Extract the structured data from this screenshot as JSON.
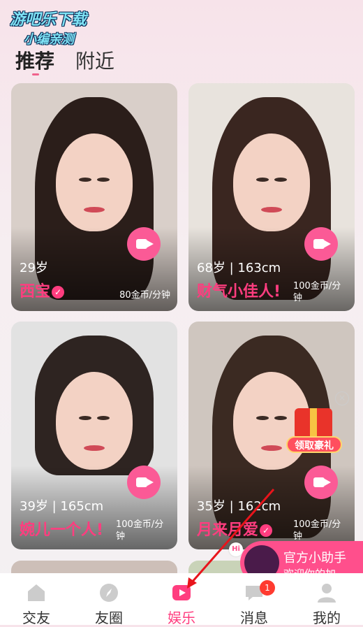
{
  "watermark": {
    "line1": "游吧乐下载",
    "line2": "小编亲测"
  },
  "tabs": [
    {
      "label": "推荐"
    },
    {
      "label": "附近"
    }
  ],
  "cards": [
    {
      "age": "29岁",
      "name": "西宝",
      "price": "80金币/分钟"
    },
    {
      "age": "68岁 | 163cm",
      "name": "财气小佳人!",
      "price": "100金币/分钟"
    },
    {
      "age": "39岁 | 165cm",
      "name": "婉儿一个人!",
      "price": "100金币/分钟"
    },
    {
      "age": "35岁 | 162cm",
      "name": "月来月爱",
      "price": "100金币/分钟"
    }
  ],
  "promo": {
    "label": "领取豪礼",
    "close": "×"
  },
  "assistant": {
    "hi": "Hi",
    "title": "官方小助手",
    "subtitle": "欢迎你的加..."
  },
  "nav": [
    {
      "label": "交友",
      "icon": "home-icon"
    },
    {
      "label": "友圈",
      "icon": "compass-icon"
    },
    {
      "label": "娱乐",
      "icon": "play-icon"
    },
    {
      "label": "消息",
      "icon": "chat-icon",
      "badge": "1"
    },
    {
      "label": "我的",
      "icon": "person-icon"
    }
  ],
  "colors": {
    "accent": "#ff3d7f",
    "video": "#fb5a96"
  }
}
